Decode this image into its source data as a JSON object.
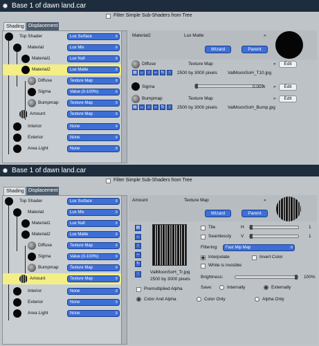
{
  "window_title": "Base 1 of dawn land.car",
  "filter_label": "Filter Simple Sub-Shaders from Tree",
  "tabs": [
    "Shading",
    "Displacement"
  ],
  "tree_rows": [
    {
      "label": "Top Shader",
      "value": "Lux Surface"
    },
    {
      "label": "Material",
      "value": "Lux Mix"
    },
    {
      "label": "Material1",
      "value": "Lux Null"
    },
    {
      "label": "Material2",
      "value": "Lux Matte"
    },
    {
      "label": "Diffuse",
      "value": "Texture Map"
    },
    {
      "label": "Sigma",
      "value": "Value (0-100%)"
    },
    {
      "label": "Bumpmap",
      "value": "Texture Map"
    },
    {
      "label": "Amount",
      "value": "Texture Map"
    },
    {
      "label": "Interior",
      "value": "None"
    },
    {
      "label": "Exterior",
      "value": "None"
    },
    {
      "label": "Area Light",
      "value": "None"
    }
  ],
  "panel1": {
    "header_name": "Material2",
    "header_type": "Lux Matte",
    "wizard_label": "Wizard",
    "parent_label": "Parent",
    "edit_label": "Edit",
    "diffuse": {
      "label": "Diffuse",
      "value": "Texture Map",
      "size": "2500 by 3000 pixels",
      "file": "ValMoonSoH_T10.jpg"
    },
    "sigma": {
      "label": "Sigma",
      "percent": "0.00%"
    },
    "bumpmap": {
      "label": "Bumpmap",
      "value": "Texture Map",
      "size": "2500 by 3000 pixels",
      "file": "ValMoonSoH_Bump.jpg"
    }
  },
  "panel2": {
    "header_name": "Amount",
    "header_type": "Texture Map",
    "wizard_label": "Wizard",
    "parent_label": "Parent",
    "tile_label": "Tile",
    "seamless_label": "Seamlessly",
    "h_label": "H",
    "v_label": "V",
    "h_value": "1",
    "v_value": "1",
    "filtering_label": "Filtering:",
    "filtering_value": "Fast Mip Map",
    "interpolate_label": "Interpolate",
    "invert_label": "Invert Color",
    "white_invisible_label": "White is invisible",
    "brightness_label": "Brightness:",
    "brightness_value": "100%",
    "brightness_fraction": 1.0,
    "save_label": "Save:",
    "internally_label": "Internally",
    "externally_label": "Externally",
    "file": "ValMoonSoH_Tr.jpg",
    "size": "2500 by 3000 pixels",
    "premult_label": "Premultiplied Alpha",
    "color_alpha_label": "Color And Alpha",
    "color_only_label": "Color Only",
    "alpha_only_label": "Alpha Only"
  }
}
